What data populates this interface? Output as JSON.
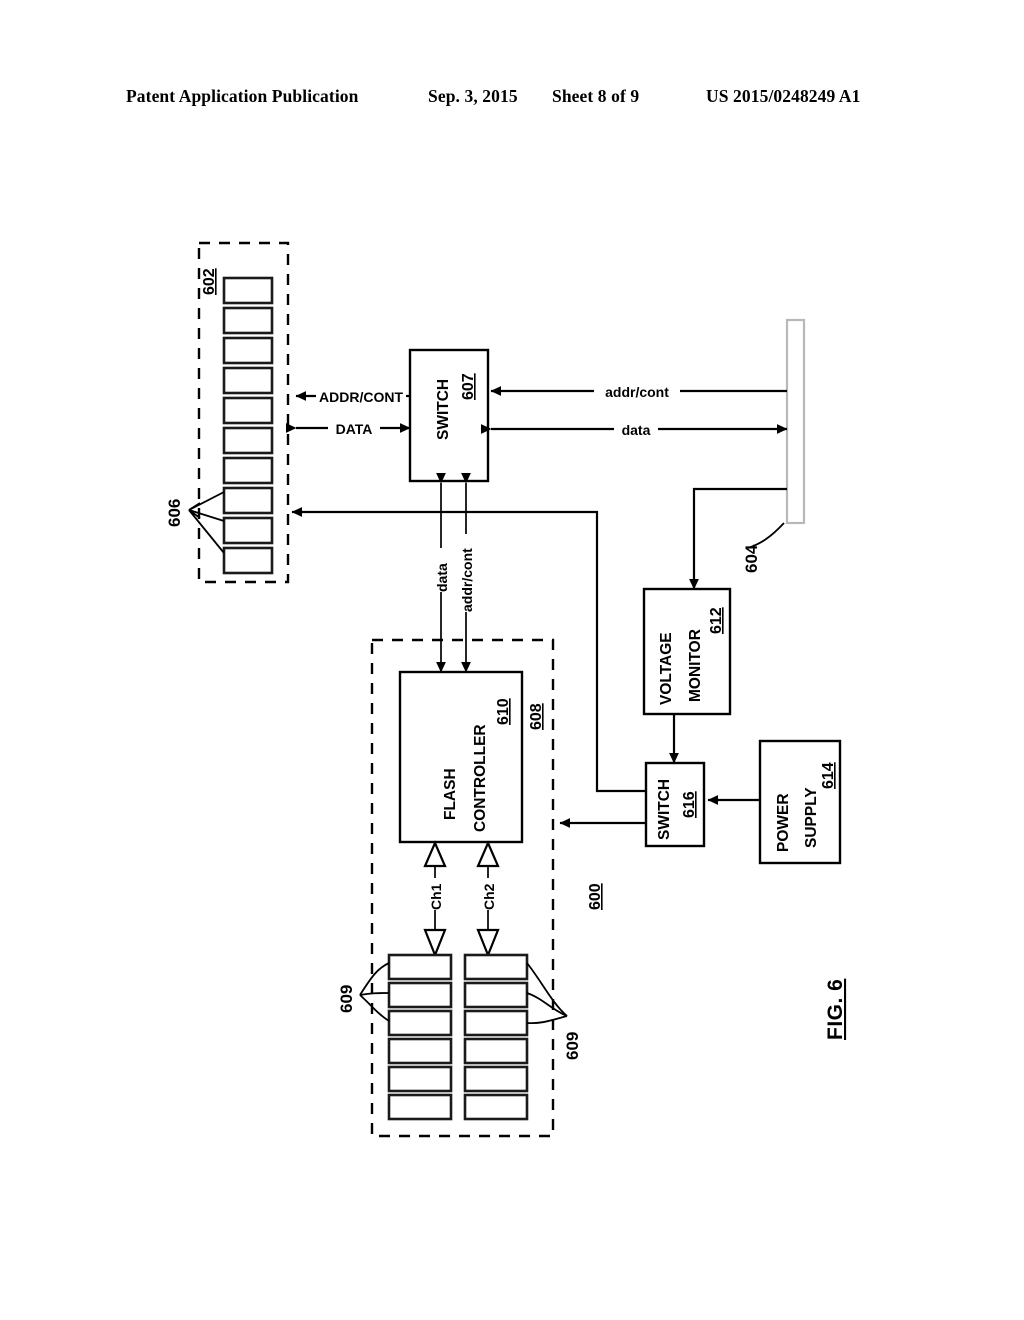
{
  "header": {
    "publication": "Patent Application Publication",
    "date": "Sep. 3, 2015",
    "sheet": "Sheet 8 of 9",
    "pub_number": "US 2015/0248249 A1"
  },
  "figure": {
    "label": "FIG. 6",
    "system_ref": "600"
  },
  "blocks": {
    "switch_607": {
      "title": "SWITCH",
      "ref": "607"
    },
    "flash_controller_610": {
      "title_line1": "FLASH",
      "title_line2": "CONTROLLER",
      "ref": "610"
    },
    "voltage_monitor_612": {
      "title_line1": "VOLTAGE",
      "title_line2": "MONITOR",
      "ref": "612"
    },
    "power_supply_614": {
      "title_line1": "POWER",
      "title_line2": "SUPPLY",
      "ref": "614"
    },
    "switch_616": {
      "title": "SWITCH",
      "ref": "616"
    }
  },
  "groups": {
    "dram_enclosure": {
      "ref": "602",
      "chip_count": 10,
      "chip_ref": "606"
    },
    "ssd_enclosure": {
      "ref": "608",
      "flash_ref_left": "609",
      "flash_ref_right": "609",
      "columns": 2,
      "rows_per_column": 6
    },
    "host_bar": {
      "ref": "604"
    }
  },
  "signals": {
    "addr_cont_upper": "ADDR/CONT",
    "data_upper": "DATA",
    "addr_cont_host": "addr/cont",
    "data_host": "data",
    "data_lower": "data",
    "addr_cont_lower": "addr/cont",
    "channel_1": "Ch1",
    "channel_2": "Ch2"
  },
  "colors": {
    "ink": "#000000",
    "paper": "#ffffff",
    "bar_outline": "#b8b8b8"
  }
}
